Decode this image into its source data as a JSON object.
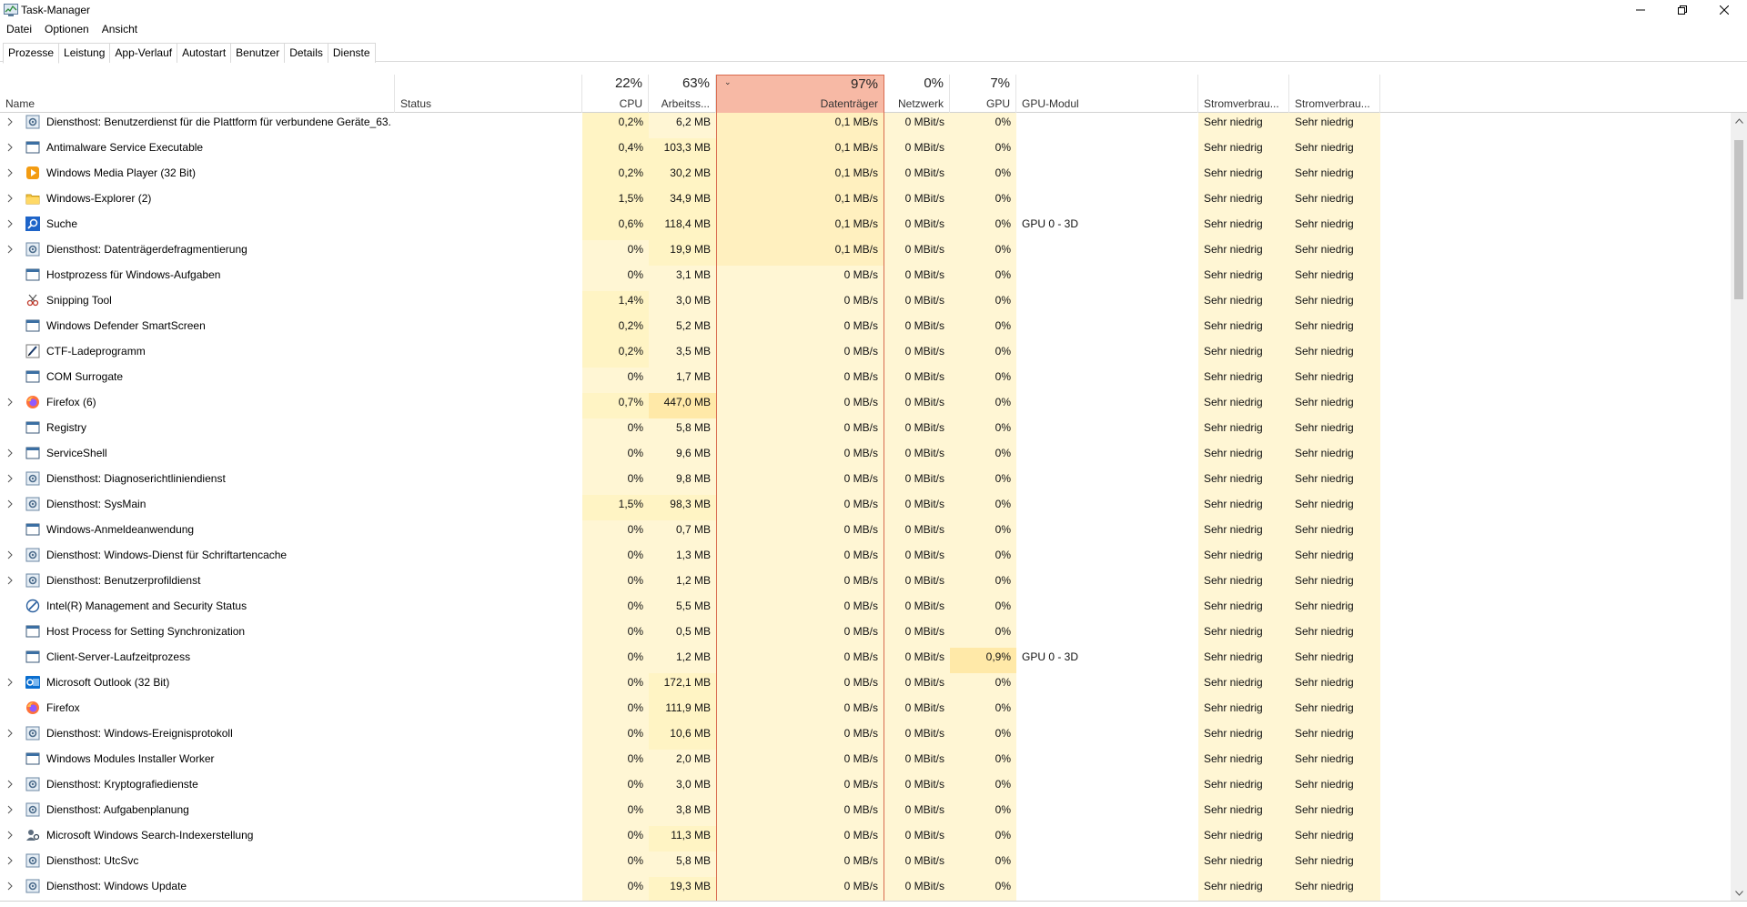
{
  "window": {
    "title": "Task-Manager",
    "icon": "task-manager-icon"
  },
  "menu": [
    "Datei",
    "Optionen",
    "Ansicht"
  ],
  "tabs": [
    "Prozesse",
    "Leistung",
    "App-Verlauf",
    "Autostart",
    "Benutzer",
    "Details",
    "Dienste"
  ],
  "active_tab": "Prozesse",
  "columns": {
    "name": {
      "label": "Name"
    },
    "status": {
      "label": "Status"
    },
    "cpu": {
      "label": "CPU",
      "pct": "22%"
    },
    "mem": {
      "label": "Arbeitss...",
      "pct": "63%"
    },
    "disk": {
      "label": "Datenträger",
      "pct": "97%"
    },
    "net": {
      "label": "Netzwerk",
      "pct": "0%"
    },
    "gpu": {
      "label": "GPU",
      "pct": "7%"
    },
    "gpumod": {
      "label": "GPU-Modul"
    },
    "power": {
      "label": "Stromverbrau..."
    },
    "powertrend": {
      "label": "Stromverbrau..."
    }
  },
  "colors": {
    "sorted_header": "#f7b9a5",
    "heat_low": "#fff4c4",
    "heat_mid": "#ffe9a8"
  },
  "rows": [
    {
      "expand": true,
      "icon": "gear-icon",
      "name": "Diensthost: Benutzerdienst für die Plattform für verbundene Geräte_63...",
      "cpu": "0,2%",
      "mem": "6,2 MB",
      "disk": "0,1 MB/s",
      "net": "0 MBit/s",
      "gpu": "0%",
      "gpumod": "",
      "power": "Sehr niedrig",
      "powertrend": "Sehr niedrig"
    },
    {
      "expand": true,
      "icon": "window-icon",
      "name": "Antimalware Service Executable",
      "cpu": "0,4%",
      "mem": "103,3 MB",
      "disk": "0,1 MB/s",
      "net": "0 MBit/s",
      "gpu": "0%",
      "gpumod": "",
      "power": "Sehr niedrig",
      "powertrend": "Sehr niedrig"
    },
    {
      "expand": true,
      "icon": "media-player-icon",
      "name": "Windows Media Player (32 Bit)",
      "cpu": "0,2%",
      "mem": "30,2 MB",
      "disk": "0,1 MB/s",
      "net": "0 MBit/s",
      "gpu": "0%",
      "gpumod": "",
      "power": "Sehr niedrig",
      "powertrend": "Sehr niedrig"
    },
    {
      "expand": true,
      "icon": "folder-icon",
      "name": "Windows-Explorer (2)",
      "cpu": "1,5%",
      "mem": "34,9 MB",
      "disk": "0,1 MB/s",
      "net": "0 MBit/s",
      "gpu": "0%",
      "gpumod": "",
      "power": "Sehr niedrig",
      "powertrend": "Sehr niedrig"
    },
    {
      "expand": true,
      "icon": "search-icon",
      "name": "Suche",
      "cpu": "0,6%",
      "mem": "118,4 MB",
      "disk": "0,1 MB/s",
      "net": "0 MBit/s",
      "gpu": "0%",
      "gpumod": "GPU 0 - 3D",
      "power": "Sehr niedrig",
      "powertrend": "Sehr niedrig"
    },
    {
      "expand": true,
      "icon": "gear-icon",
      "name": "Diensthost: Datenträgerdefragmentierung",
      "cpu": "0%",
      "mem": "19,9 MB",
      "disk": "0,1 MB/s",
      "net": "0 MBit/s",
      "gpu": "0%",
      "gpumod": "",
      "power": "Sehr niedrig",
      "powertrend": "Sehr niedrig"
    },
    {
      "expand": false,
      "icon": "window-icon",
      "name": "Hostprozess für Windows-Aufgaben",
      "cpu": "0%",
      "mem": "3,1 MB",
      "disk": "0 MB/s",
      "net": "0 MBit/s",
      "gpu": "0%",
      "gpumod": "",
      "power": "Sehr niedrig",
      "powertrend": "Sehr niedrig"
    },
    {
      "expand": false,
      "icon": "snipping-icon",
      "name": "Snipping Tool",
      "cpu": "1,4%",
      "mem": "3,0 MB",
      "disk": "0 MB/s",
      "net": "0 MBit/s",
      "gpu": "0%",
      "gpumod": "",
      "power": "Sehr niedrig",
      "powertrend": "Sehr niedrig"
    },
    {
      "expand": false,
      "icon": "window-icon",
      "name": "Windows Defender SmartScreen",
      "cpu": "0,2%",
      "mem": "5,2 MB",
      "disk": "0 MB/s",
      "net": "0 MBit/s",
      "gpu": "0%",
      "gpumod": "",
      "power": "Sehr niedrig",
      "powertrend": "Sehr niedrig"
    },
    {
      "expand": false,
      "icon": "pen-icon",
      "name": "CTF-Ladeprogramm",
      "cpu": "0,2%",
      "mem": "3,5 MB",
      "disk": "0 MB/s",
      "net": "0 MBit/s",
      "gpu": "0%",
      "gpumod": "",
      "power": "Sehr niedrig",
      "powertrend": "Sehr niedrig"
    },
    {
      "expand": false,
      "icon": "window-icon",
      "name": "COM Surrogate",
      "cpu": "0%",
      "mem": "1,7 MB",
      "disk": "0 MB/s",
      "net": "0 MBit/s",
      "gpu": "0%",
      "gpumod": "",
      "power": "Sehr niedrig",
      "powertrend": "Sehr niedrig"
    },
    {
      "expand": true,
      "icon": "firefox-icon",
      "name": "Firefox (6)",
      "cpu": "0,7%",
      "mem": "447,0 MB",
      "disk": "0 MB/s",
      "net": "0 MBit/s",
      "gpu": "0%",
      "gpumod": "",
      "power": "Sehr niedrig",
      "powertrend": "Sehr niedrig"
    },
    {
      "expand": false,
      "icon": "window-icon",
      "name": "Registry",
      "cpu": "0%",
      "mem": "5,8 MB",
      "disk": "0 MB/s",
      "net": "0 MBit/s",
      "gpu": "0%",
      "gpumod": "",
      "power": "Sehr niedrig",
      "powertrend": "Sehr niedrig"
    },
    {
      "expand": true,
      "icon": "window-icon",
      "name": "ServiceShell",
      "cpu": "0%",
      "mem": "9,6 MB",
      "disk": "0 MB/s",
      "net": "0 MBit/s",
      "gpu": "0%",
      "gpumod": "",
      "power": "Sehr niedrig",
      "powertrend": "Sehr niedrig"
    },
    {
      "expand": true,
      "icon": "gear-icon",
      "name": "Diensthost: Diagnoserichtliniendienst",
      "cpu": "0%",
      "mem": "9,8 MB",
      "disk": "0 MB/s",
      "net": "0 MBit/s",
      "gpu": "0%",
      "gpumod": "",
      "power": "Sehr niedrig",
      "powertrend": "Sehr niedrig"
    },
    {
      "expand": true,
      "icon": "gear-icon",
      "name": "Diensthost: SysMain",
      "cpu": "1,5%",
      "mem": "98,3 MB",
      "disk": "0 MB/s",
      "net": "0 MBit/s",
      "gpu": "0%",
      "gpumod": "",
      "power": "Sehr niedrig",
      "powertrend": "Sehr niedrig"
    },
    {
      "expand": false,
      "icon": "window-icon",
      "name": "Windows-Anmeldeanwendung",
      "cpu": "0%",
      "mem": "0,7 MB",
      "disk": "0 MB/s",
      "net": "0 MBit/s",
      "gpu": "0%",
      "gpumod": "",
      "power": "Sehr niedrig",
      "powertrend": "Sehr niedrig"
    },
    {
      "expand": true,
      "icon": "gear-icon",
      "name": "Diensthost: Windows-Dienst für Schriftartencache",
      "cpu": "0%",
      "mem": "1,3 MB",
      "disk": "0 MB/s",
      "net": "0 MBit/s",
      "gpu": "0%",
      "gpumod": "",
      "power": "Sehr niedrig",
      "powertrend": "Sehr niedrig"
    },
    {
      "expand": true,
      "icon": "gear-icon",
      "name": "Diensthost: Benutzerprofildienst",
      "cpu": "0%",
      "mem": "1,2 MB",
      "disk": "0 MB/s",
      "net": "0 MBit/s",
      "gpu": "0%",
      "gpumod": "",
      "power": "Sehr niedrig",
      "powertrend": "Sehr niedrig"
    },
    {
      "expand": false,
      "icon": "intel-icon",
      "name": "Intel(R) Management and Security Status",
      "cpu": "0%",
      "mem": "5,5 MB",
      "disk": "0 MB/s",
      "net": "0 MBit/s",
      "gpu": "0%",
      "gpumod": "",
      "power": "Sehr niedrig",
      "powertrend": "Sehr niedrig"
    },
    {
      "expand": false,
      "icon": "window-icon",
      "name": "Host Process for Setting Synchronization",
      "cpu": "0%",
      "mem": "0,5 MB",
      "disk": "0 MB/s",
      "net": "0 MBit/s",
      "gpu": "0%",
      "gpumod": "",
      "power": "Sehr niedrig",
      "powertrend": "Sehr niedrig"
    },
    {
      "expand": false,
      "icon": "window-icon",
      "name": "Client-Server-Laufzeitprozess",
      "cpu": "0%",
      "mem": "1,2 MB",
      "disk": "0 MB/s",
      "net": "0 MBit/s",
      "gpu": "0,9%",
      "gpumod": "GPU 0 - 3D",
      "power": "Sehr niedrig",
      "powertrend": "Sehr niedrig"
    },
    {
      "expand": true,
      "icon": "outlook-icon",
      "name": "Microsoft Outlook (32 Bit)",
      "cpu": "0%",
      "mem": "172,1 MB",
      "disk": "0 MB/s",
      "net": "0 MBit/s",
      "gpu": "0%",
      "gpumod": "",
      "power": "Sehr niedrig",
      "powertrend": "Sehr niedrig"
    },
    {
      "expand": false,
      "icon": "firefox-icon",
      "name": "Firefox",
      "cpu": "0%",
      "mem": "111,9 MB",
      "disk": "0 MB/s",
      "net": "0 MBit/s",
      "gpu": "0%",
      "gpumod": "",
      "power": "Sehr niedrig",
      "powertrend": "Sehr niedrig"
    },
    {
      "expand": true,
      "icon": "gear-icon",
      "name": "Diensthost: Windows-Ereignisprotokoll",
      "cpu": "0%",
      "mem": "10,6 MB",
      "disk": "0 MB/s",
      "net": "0 MBit/s",
      "gpu": "0%",
      "gpumod": "",
      "power": "Sehr niedrig",
      "powertrend": "Sehr niedrig"
    },
    {
      "expand": false,
      "icon": "window-icon",
      "name": "Windows Modules Installer Worker",
      "cpu": "0%",
      "mem": "2,0 MB",
      "disk": "0 MB/s",
      "net": "0 MBit/s",
      "gpu": "0%",
      "gpumod": "",
      "power": "Sehr niedrig",
      "powertrend": "Sehr niedrig"
    },
    {
      "expand": true,
      "icon": "gear-icon",
      "name": "Diensthost: Kryptografiedienste",
      "cpu": "0%",
      "mem": "3,0 MB",
      "disk": "0 MB/s",
      "net": "0 MBit/s",
      "gpu": "0%",
      "gpumod": "",
      "power": "Sehr niedrig",
      "powertrend": "Sehr niedrig"
    },
    {
      "expand": true,
      "icon": "gear-icon",
      "name": "Diensthost: Aufgabenplanung",
      "cpu": "0%",
      "mem": "3,8 MB",
      "disk": "0 MB/s",
      "net": "0 MBit/s",
      "gpu": "0%",
      "gpumod": "",
      "power": "Sehr niedrig",
      "powertrend": "Sehr niedrig"
    },
    {
      "expand": true,
      "icon": "search-indexer-icon",
      "name": "Microsoft Windows Search-Indexerstellung",
      "cpu": "0%",
      "mem": "11,3 MB",
      "disk": "0 MB/s",
      "net": "0 MBit/s",
      "gpu": "0%",
      "gpumod": "",
      "power": "Sehr niedrig",
      "powertrend": "Sehr niedrig"
    },
    {
      "expand": true,
      "icon": "gear-icon",
      "name": "Diensthost: UtcSvc",
      "cpu": "0%",
      "mem": "5,8 MB",
      "disk": "0 MB/s",
      "net": "0 MBit/s",
      "gpu": "0%",
      "gpumod": "",
      "power": "Sehr niedrig",
      "powertrend": "Sehr niedrig"
    },
    {
      "expand": true,
      "icon": "gear-icon",
      "name": "Diensthost: Windows Update",
      "cpu": "0%",
      "mem": "19,3 MB",
      "disk": "0 MB/s",
      "net": "0 MBit/s",
      "gpu": "0%",
      "gpumod": "",
      "power": "Sehr niedrig",
      "powertrend": "Sehr niedrig"
    }
  ]
}
